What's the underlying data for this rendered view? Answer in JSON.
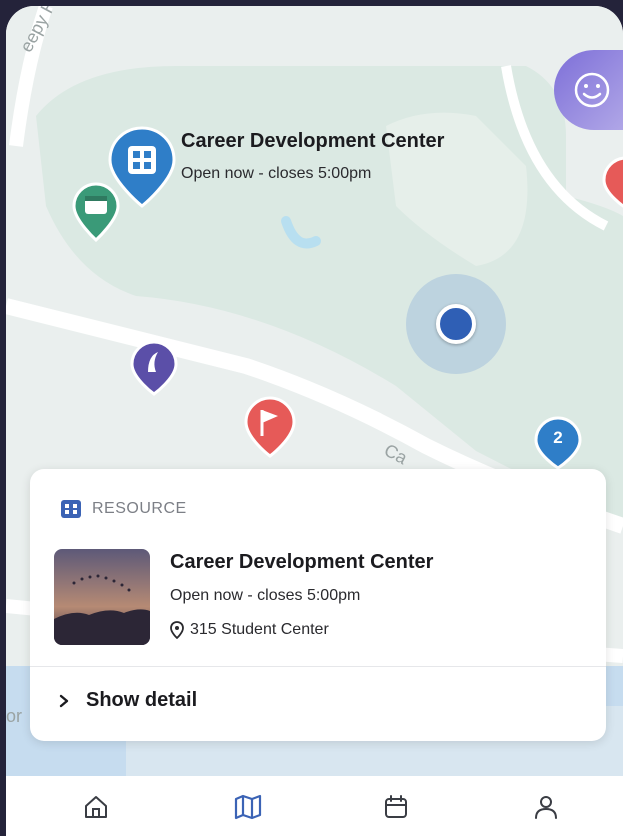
{
  "map": {
    "road_top": "eepy Hollo",
    "road_bottom": "Ca",
    "road_left": "or",
    "callout": {
      "title": "Career Development Center",
      "subtitle": "Open now - closes 5:00pm"
    },
    "cluster_count": "2",
    "colors": {
      "pin_blue": "#2f7ec8",
      "pin_green": "#3a9a78",
      "pin_purple": "#5b4fa8",
      "pin_red": "#e65a58",
      "user_dot": "#2f5fb5"
    }
  },
  "card": {
    "kind_label": "RESOURCE",
    "title": "Career Development Center",
    "hours": "Open now - closes 5:00pm",
    "address": "315 Student Center",
    "show_detail_label": "Show detail"
  },
  "tabbar": {
    "tabs": [
      "home-icon",
      "map-icon",
      "calendar-icon",
      "profile-icon"
    ],
    "active": "map-icon"
  }
}
